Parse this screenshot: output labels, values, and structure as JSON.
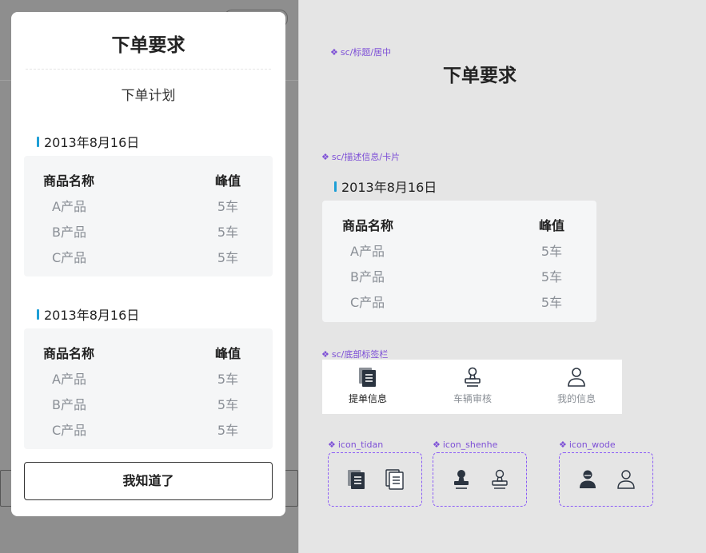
{
  "modal": {
    "title": "下单要求",
    "subtitle": "下单计划",
    "groups": [
      {
        "date": "2013年8月16日",
        "header": {
          "name": "商品名称",
          "value": "峰值"
        },
        "rows": [
          {
            "name": "A产品",
            "value": "5车"
          },
          {
            "name": "B产品",
            "value": "5车"
          },
          {
            "name": "C产品",
            "value": "5车"
          }
        ]
      },
      {
        "date": "2013年8月16日",
        "header": {
          "name": "商品名称",
          "value": "峰值"
        },
        "rows": [
          {
            "name": "A产品",
            "value": "5车"
          },
          {
            "name": "B产品",
            "value": "5车"
          },
          {
            "name": "C产品",
            "value": "5车"
          }
        ]
      }
    ],
    "confirm_label": "我知道了"
  },
  "components": {
    "title_label": "sc/标题/居中",
    "title_text": "下单要求",
    "card_label": "sc/描述信息/卡片",
    "card": {
      "date": "2013年8月16日",
      "header": {
        "name": "商品名称",
        "value": "峰值"
      },
      "rows": [
        {
          "name": "A产品",
          "value": "5车"
        },
        {
          "name": "B产品",
          "value": "5车"
        },
        {
          "name": "C产品",
          "value": "5车"
        }
      ]
    },
    "tabbar_label": "sc/底部标签栏",
    "tabs": [
      {
        "label": "提单信息",
        "icon": "document-icon",
        "active": true
      },
      {
        "label": "车辆审核",
        "icon": "stamp-icon",
        "active": false
      },
      {
        "label": "我的信息",
        "icon": "user-icon",
        "active": false
      }
    ],
    "icon_sets": [
      {
        "label": "icon_tidan"
      },
      {
        "label": "icon_shenhe"
      },
      {
        "label": "icon_wode"
      }
    ]
  },
  "colors": {
    "accent": "#1e9fd6",
    "component_marker": "#7d4fd6",
    "tab_active": "#222222",
    "tab_inactive": "#8a8f96"
  }
}
